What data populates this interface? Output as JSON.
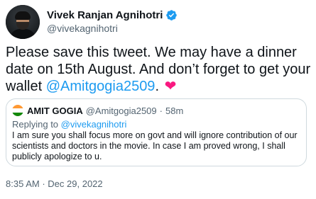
{
  "author": {
    "name": "Vivek Ranjan Agnihotri",
    "handle": "@vivekagnihotri",
    "verified_color": "#1d9bf0"
  },
  "tweet": {
    "text_before": "Please save this tweet. We may have a dinner date on 15th August. And don’t forget to get your wallet ",
    "mention": "@Amitgogia2509",
    "text_after": ". ",
    "heart": "❤"
  },
  "quote": {
    "name": "AMIT GOGIA",
    "handle": "@Amitgogia2509",
    "separator": "·",
    "time": "58m",
    "replying_prefix": "Replying to ",
    "replying_to": "@vivekagnihotri",
    "text": "I am sure you shall focus more on govt and will ignore contribution of our scientists and doctors in the movie.  In case I am proved wrong, I shall publicly apologize to u."
  },
  "timestamp": {
    "time": "8:35 AM",
    "separator": "·",
    "date": "Dec 29, 2022"
  },
  "colors": {
    "link": "#1d9bf0",
    "heart": "#f91880",
    "muted": "#536471",
    "border": "#cfd9de"
  }
}
